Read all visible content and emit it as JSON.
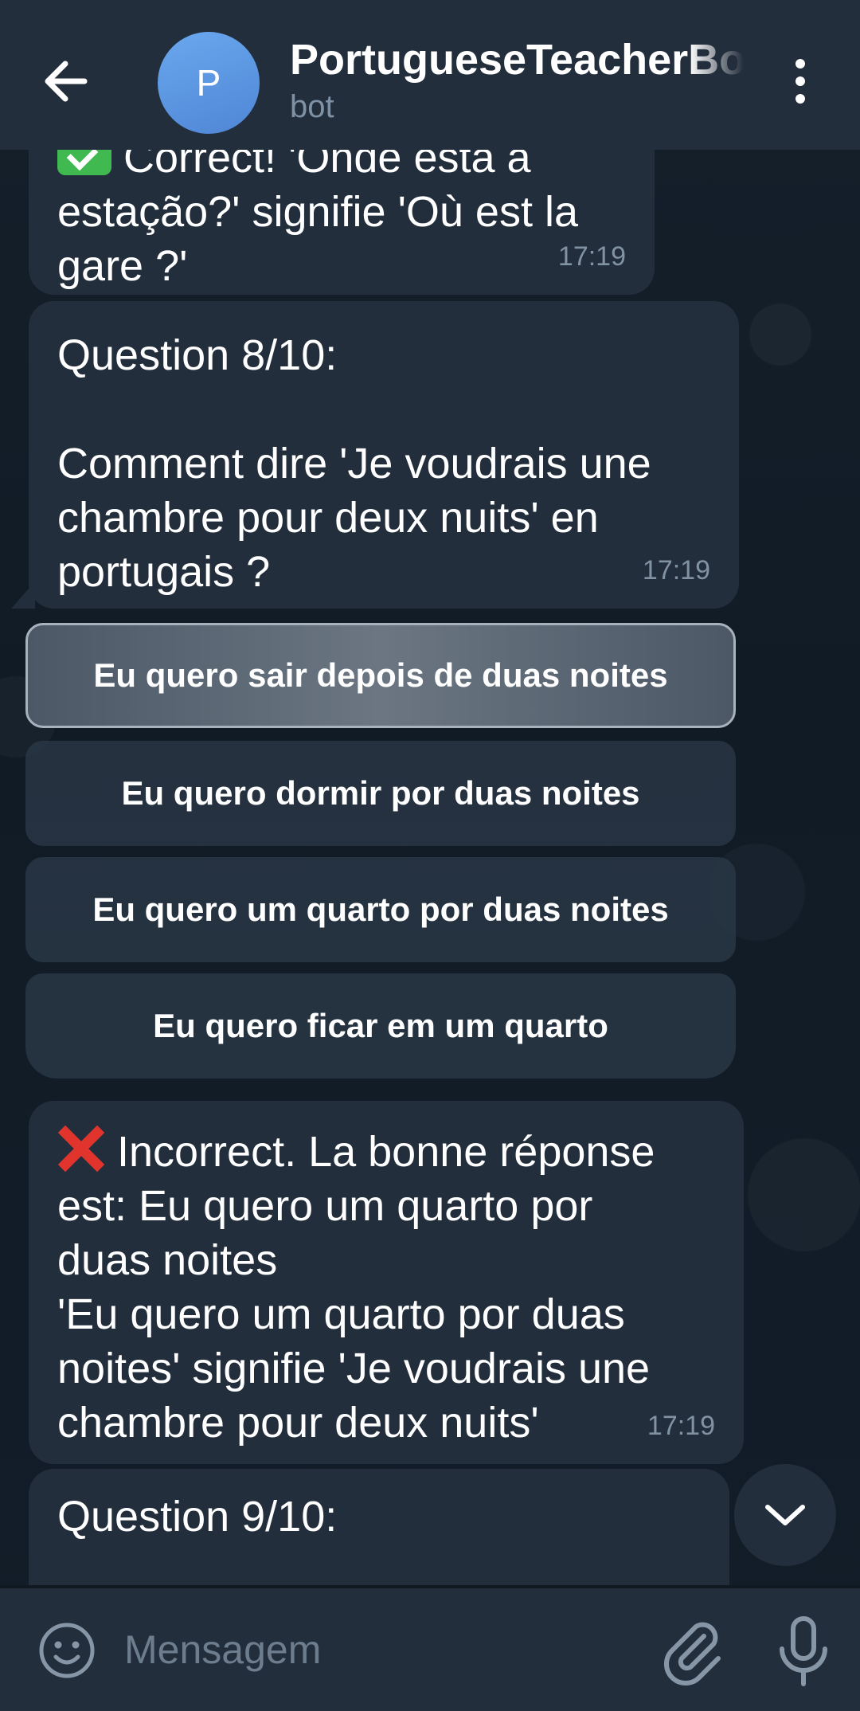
{
  "header": {
    "title": "PortugueseTeacherBot",
    "subtitle": "bot",
    "avatar_letter": "P"
  },
  "messages": [
    {
      "text": "Correct! 'Onde está a estação?' signifie 'Où est la gare ?'",
      "line1": "Correct! 'Onde está a",
      "line_rest": "estação?' signifie 'Où est la\ngare ?'",
      "time": "17:19"
    },
    {
      "text": "Question 8/10:\n\nComment dire 'Je voudrais une chambre pour deux nuits' en portugais ?",
      "time": "17:19"
    },
    {
      "text": " Incorrect. La bonne réponse est: Eu quero um quarto por duas noites\n'Eu quero um quarto por duas noites' signifie 'Je voudrais une chambre pour deux nuits'",
      "display": " Incorrect. La bonne réponse\nest: Eu quero um quarto por\nduas noites\n'Eu quero um quarto por duas\nnoites' signifie 'Je voudrais une\nchambre pour deux nuits'",
      "time": "17:19"
    },
    {
      "text": "Question 9/10:"
    }
  ],
  "question8_display": "Question 8/10:\n\nComment dire 'Je voudrais une\nchambre pour deux nuits' en\nportugais ?",
  "keyboard": {
    "options": [
      "Eu quero sair depois de duas noites",
      "Eu quero dormir por duas noites",
      "Eu quero um quarto por duas noites",
      "Eu quero ficar em um quarto"
    ]
  },
  "input": {
    "placeholder": "Mensagem"
  },
  "icons": {
    "back": "arrow-left-icon",
    "menu": "more-vertical-icon",
    "check": "check-mark-emoji",
    "cross": "cross-mark-emoji",
    "scroll": "chevron-down-icon",
    "emoji": "smiley-icon",
    "attach": "paperclip-icon",
    "mic": "microphone-icon"
  },
  "colors": {
    "header_bg": "#232e3c",
    "bubble_bg": "#232e3c",
    "time_text": "#8192a3",
    "avatar": "#5b95e0",
    "check_green": "#3fb950",
    "cross_red": "#e0342d"
  }
}
